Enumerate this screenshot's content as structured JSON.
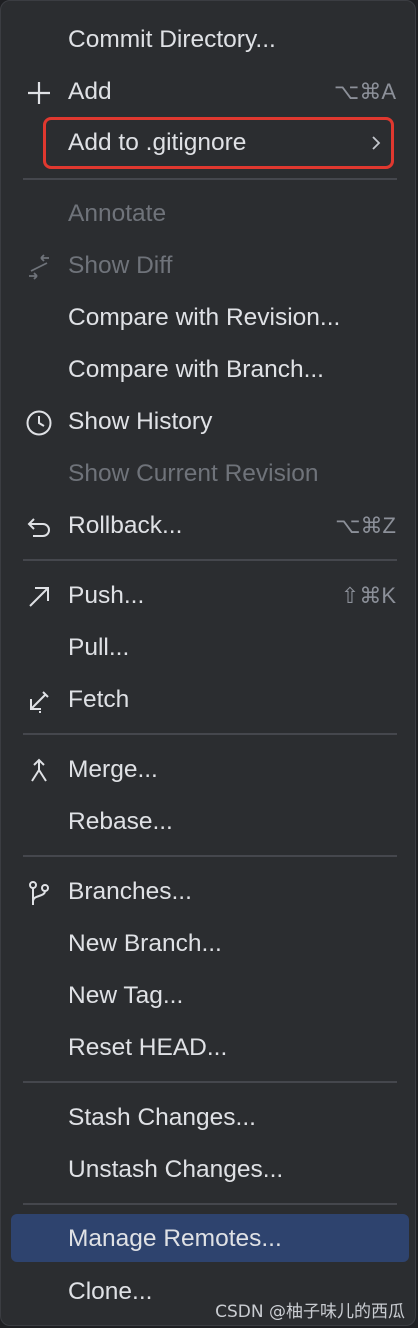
{
  "menu": {
    "items": {
      "commit_directory": {
        "label": "Commit Directory..."
      },
      "add": {
        "label": "Add",
        "shortcut": "⌥⌘A",
        "icon": "plus-icon"
      },
      "add_to_gitignore": {
        "label": "Add to .gitignore",
        "submenu": "chevron-right-icon"
      },
      "annotate": {
        "label": "Annotate",
        "disabled": true
      },
      "show_diff": {
        "label": "Show Diff",
        "disabled": true,
        "icon": "diff-arrows-icon"
      },
      "compare_with_revision": {
        "label": "Compare with Revision..."
      },
      "compare_with_branch": {
        "label": "Compare with Branch..."
      },
      "show_history": {
        "label": "Show History",
        "icon": "clock-icon"
      },
      "show_current_revision": {
        "label": "Show Current Revision",
        "disabled": true
      },
      "rollback": {
        "label": "Rollback...",
        "shortcut": "⌥⌘Z",
        "icon": "undo-icon"
      },
      "push": {
        "label": "Push...",
        "shortcut": "⇧⌘K",
        "icon": "arrow-up-right-icon"
      },
      "pull": {
        "label": "Pull..."
      },
      "fetch": {
        "label": "Fetch",
        "icon": "arrow-down-left-icon"
      },
      "merge": {
        "label": "Merge...",
        "icon": "merge-icon"
      },
      "rebase": {
        "label": "Rebase..."
      },
      "branches": {
        "label": "Branches...",
        "icon": "branch-icon"
      },
      "new_branch": {
        "label": "New Branch..."
      },
      "new_tag": {
        "label": "New Tag..."
      },
      "reset_head": {
        "label": "Reset HEAD..."
      },
      "stash_changes": {
        "label": "Stash Changes..."
      },
      "unstash_changes": {
        "label": "Unstash Changes..."
      },
      "manage_remotes": {
        "label": "Manage Remotes...",
        "selected": true
      },
      "clone": {
        "label": "Clone..."
      }
    }
  },
  "watermark": {
    "text": "CSDN @柚子味儿的西瓜"
  },
  "colors": {
    "background": "#2b2d30",
    "text": "#dfe1e5",
    "disabled_text": "#6f737a",
    "shortcut_text": "#8c9099",
    "selection": "#2e436e",
    "highlight_border": "#e0382f",
    "separator": "#45474d"
  }
}
